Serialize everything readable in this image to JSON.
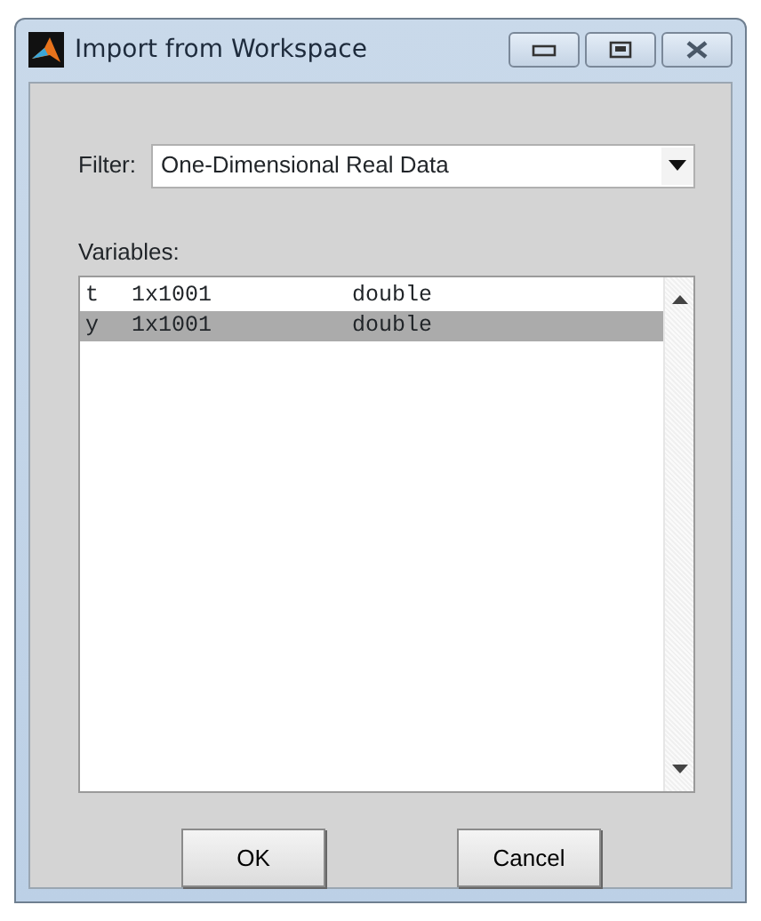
{
  "window": {
    "title": "Import from Workspace"
  },
  "filter": {
    "label": "Filter:",
    "value": "One-Dimensional Real Data"
  },
  "variables": {
    "label": "Variables:",
    "rows": [
      {
        "name": "t",
        "size": "1x1001",
        "class": "double",
        "selected": false
      },
      {
        "name": "y",
        "size": "1x1001",
        "class": "double",
        "selected": true
      }
    ]
  },
  "buttons": [
    "OK",
    "Cancel"
  ]
}
